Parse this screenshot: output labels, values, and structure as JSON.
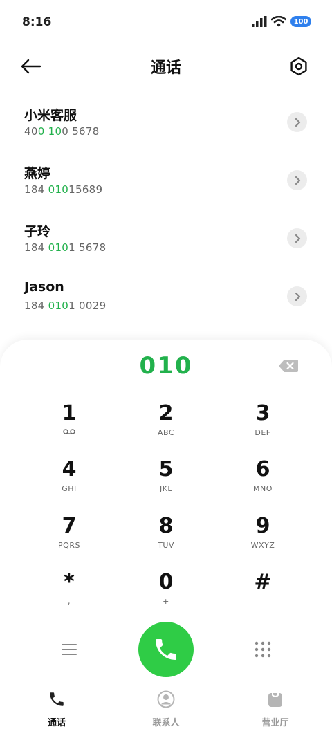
{
  "status_bar": {
    "time": "8:16",
    "battery": "100",
    "icons": [
      "signal-icon",
      "wifi-icon",
      "battery-icon"
    ]
  },
  "header": {
    "title": "通话",
    "back_icon": "arrow-left-icon",
    "settings_icon": "settings-hexagon-icon"
  },
  "contacts": [
    {
      "name": "小米客服",
      "number_parts": [
        "40",
        "0 10",
        "0 5678"
      ]
    },
    {
      "name": "燕婷",
      "number_parts": [
        "184 ",
        "010",
        "15689"
      ]
    },
    {
      "name": "子玲",
      "number_parts": [
        "184 ",
        "010",
        "1 5678"
      ]
    },
    {
      "name": "Jason",
      "number_parts": [
        "184 ",
        "010",
        "1 0029"
      ]
    }
  ],
  "dialer": {
    "input": "010",
    "keys": [
      {
        "digit": "1",
        "letters": ""
      },
      {
        "digit": "2",
        "letters": "ABC"
      },
      {
        "digit": "3",
        "letters": "DEF"
      },
      {
        "digit": "4",
        "letters": "GHI"
      },
      {
        "digit": "5",
        "letters": "JKL"
      },
      {
        "digit": "6",
        "letters": "MNO"
      },
      {
        "digit": "7",
        "letters": "PQRS"
      },
      {
        "digit": "8",
        "letters": "TUV"
      },
      {
        "digit": "9",
        "letters": "WXYZ"
      },
      {
        "digit": "*",
        "letters": ","
      },
      {
        "digit": "0",
        "letters": "+"
      },
      {
        "digit": "#",
        "letters": ""
      }
    ]
  },
  "bottom_nav": [
    {
      "label": "通话",
      "icon": "phone-icon",
      "active": true
    },
    {
      "label": "联系人",
      "icon": "contact-icon",
      "active": false
    },
    {
      "label": "营业厅",
      "icon": "store-bag-icon",
      "active": false
    }
  ],
  "colors": {
    "accent_green": "#22b14c",
    "call_button": "#2fcc46",
    "battery_blue": "#2f80ed"
  }
}
